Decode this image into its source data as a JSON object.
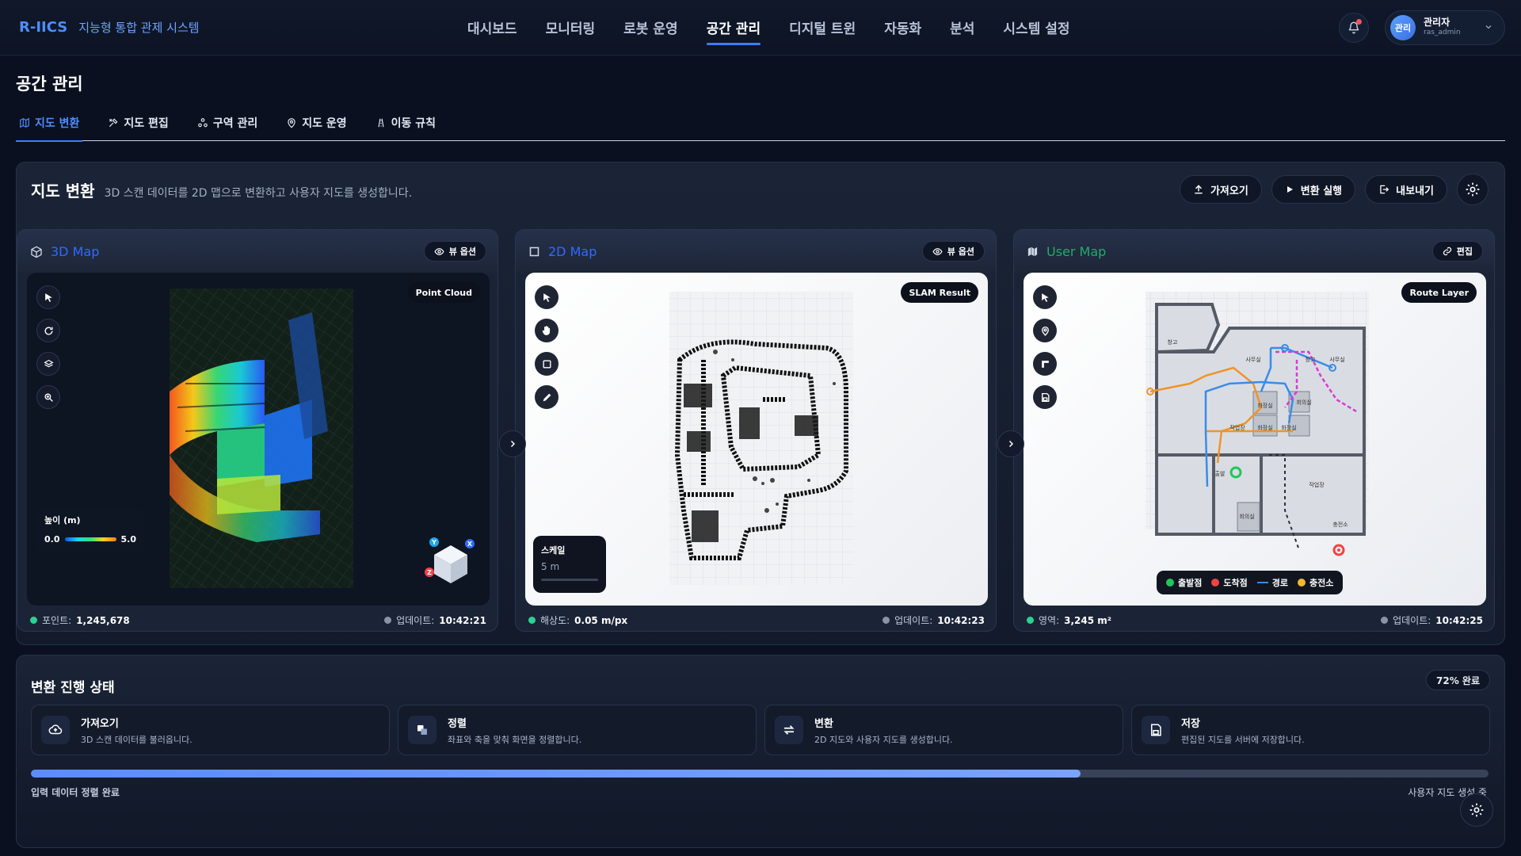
{
  "app": {
    "logo": "R-IICS",
    "subtitle": "지능형 통합 관제 시스템"
  },
  "nav": [
    "대시보드",
    "모니터링",
    "로봇 운영",
    "공간 관리",
    "디지털 트윈",
    "자동화",
    "분석",
    "시스템 설정"
  ],
  "nav_active": "공간 관리",
  "user": {
    "avatar": "관리",
    "name": "관리자",
    "id": "ras_admin"
  },
  "page_title": "공간 관리",
  "tabs": [
    {
      "label": "지도 변환",
      "icon": "map-icon"
    },
    {
      "label": "지도 편집",
      "icon": "tools-icon"
    },
    {
      "label": "구역 관리",
      "icon": "zones-icon"
    },
    {
      "label": "지도 운영",
      "icon": "pin-icon"
    },
    {
      "label": "이동 규칙",
      "icon": "road-icon"
    }
  ],
  "panel": {
    "title": "지도 변환",
    "description": "3D 스캔 데이터를 2D 맵으로 변환하고 사용자 지도를 생성합니다.",
    "actions": {
      "import": "가져오기",
      "run": "변환 실행",
      "export": "내보내기"
    }
  },
  "cards": {
    "map3d": {
      "title": "3D Map",
      "title_color": "#2f6bff",
      "button": "뷰 옵션",
      "tag": "Point Cloud",
      "legend": {
        "title": "높이 (m)",
        "min": "0.0",
        "max": "5.0"
      },
      "axes": {
        "y": "Y",
        "x": "X",
        "z": "Z"
      },
      "footer": {
        "left_label": "포인트:",
        "left_value": "1,245,678",
        "right_label": "업데이트:",
        "right_value": "10:42:21"
      }
    },
    "map2d": {
      "title": "2D Map",
      "title_color": "#2f6bff",
      "button": "뷰 옵션",
      "tag": "SLAM Result",
      "scale": {
        "title": "스케일",
        "value": "5 m"
      },
      "footer": {
        "left_label": "해상도:",
        "left_value": "0.05 m/px",
        "right_label": "업데이트:",
        "right_value": "10:42:23"
      }
    },
    "usermap": {
      "title": "User Map",
      "title_color": "#1fae6a",
      "button": "편집",
      "tag": "Route Layer",
      "rooms": [
        "창고",
        "사무실",
        "창고",
        "사무실",
        "회의실",
        "화장실",
        "작업장",
        "화장실",
        "화장실",
        "회의실",
        "출발",
        "충전소",
        "작업장"
      ],
      "legend": [
        "출발점",
        "도착점",
        "경로",
        "충전소"
      ],
      "footer": {
        "left_label": "영역:",
        "left_value": "3,245 m²",
        "right_label": "업데이트:",
        "right_value": "10:42:25"
      }
    }
  },
  "progress": {
    "title": "변환 진행 상태",
    "percent_label": "72% 완료",
    "percent": 72,
    "steps": [
      {
        "title": "가져오기",
        "desc": "3D 스캔 데이터를 불러옵니다."
      },
      {
        "title": "정렬",
        "desc": "좌표와 축을 맞춰 화면을 정렬합니다."
      },
      {
        "title": "변환",
        "desc": "2D 지도와 사용자 지도를 생성합니다."
      },
      {
        "title": "저장",
        "desc": "편집된 지도를 서버에 저장합니다."
      }
    ],
    "left_status": "입력 데이터 정렬 완료",
    "right_status": "사용자 지도 생성 중"
  },
  "colors": {
    "accent": "#3f7cff",
    "success": "#2ed18f",
    "danger": "#ff4d5e",
    "bg": "#0a1020"
  }
}
